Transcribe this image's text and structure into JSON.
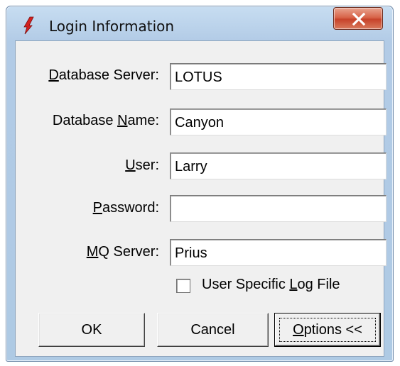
{
  "window": {
    "title": "Login Information",
    "close_label": "X"
  },
  "labels": {
    "database_server": {
      "pre": "",
      "key": "D",
      "post": "atabase Server:"
    },
    "database_name": {
      "pre": "Database ",
      "key": "N",
      "post": "ame:"
    },
    "user": {
      "pre": "",
      "key": "U",
      "post": "ser:"
    },
    "password": {
      "pre": "",
      "key": "P",
      "post": "assword:"
    },
    "mq_server": {
      "pre": "",
      "key": "M",
      "post": "Q Server:"
    }
  },
  "fields": {
    "database_server": "LOTUS",
    "database_name": "Canyon",
    "user": "Larry",
    "password": "",
    "mq_server": "Prius"
  },
  "checkbox": {
    "checked": false,
    "pre": "User Specific ",
    "key": "L",
    "post": "og File"
  },
  "buttons": {
    "ok": "OK",
    "cancel": "Cancel",
    "options": {
      "key": "O",
      "post": "ptions <<"
    }
  }
}
